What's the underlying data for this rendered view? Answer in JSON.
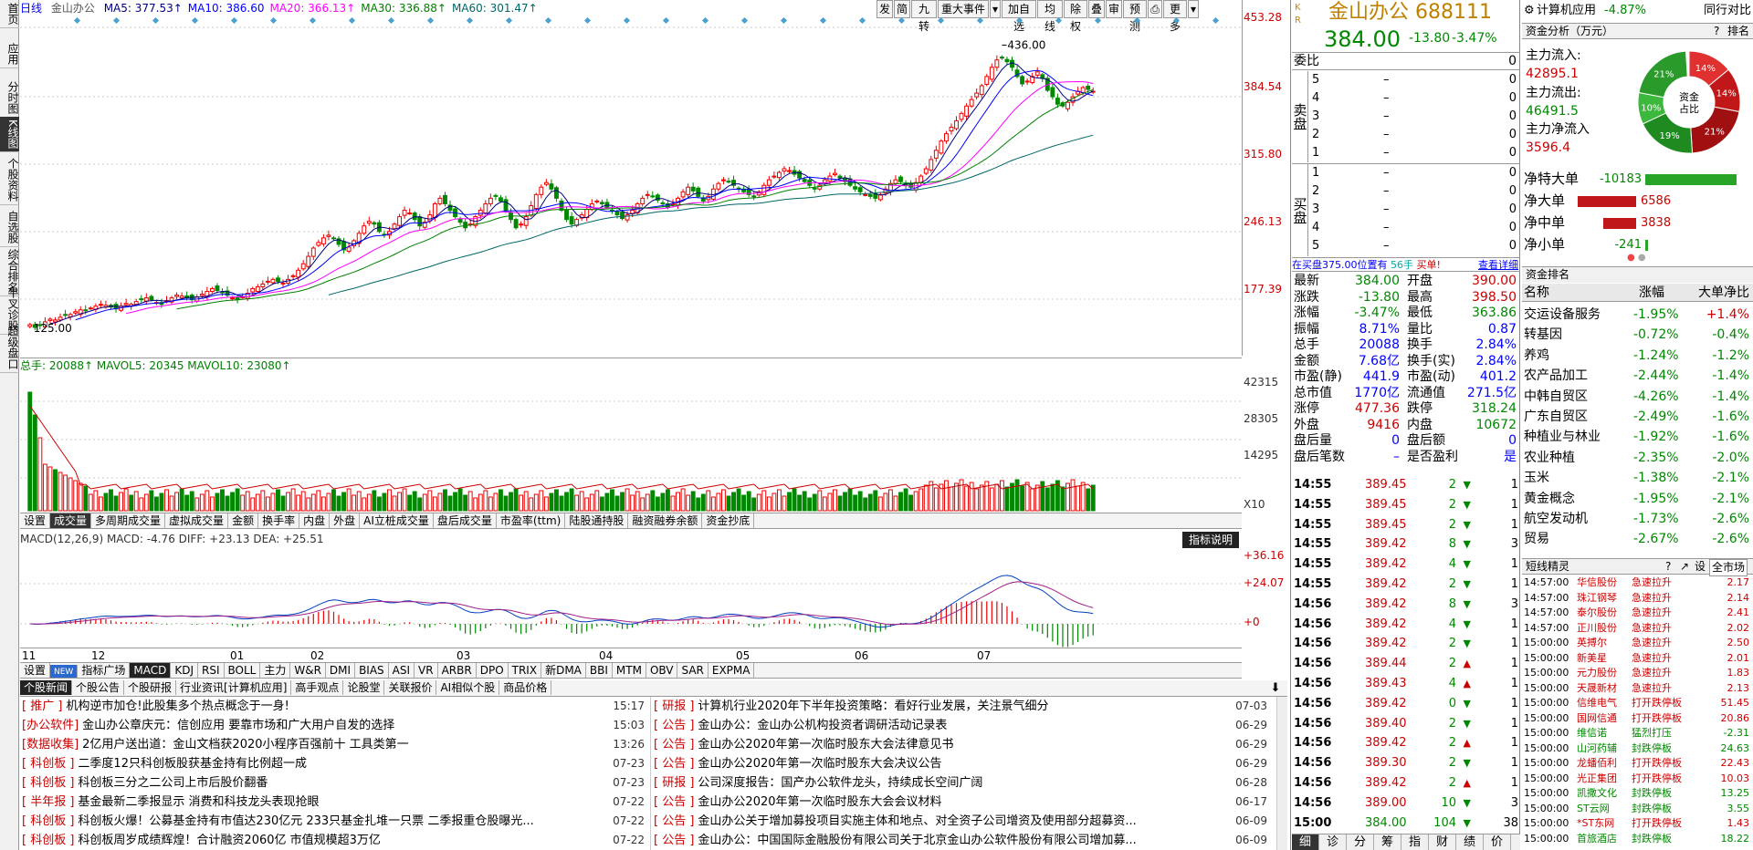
{
  "leftbar": [
    {
      "label": "首页",
      "active": false
    },
    {
      "label": "应用",
      "active": false
    },
    {
      "label": "分时图",
      "active": false
    },
    {
      "label": "K线图",
      "active": true
    },
    {
      "label": "个股资料",
      "active": false
    },
    {
      "label": "自选股",
      "active": false
    },
    {
      "label": "综合排名",
      "active": false
    },
    {
      "label": "牛叉诊股",
      "active": false
    },
    {
      "label": "超级盘口",
      "active": false
    }
  ],
  "main": {
    "period": "日线",
    "name": "金山办公",
    "ma": [
      {
        "label": "MA5: 377.53↑",
        "color": "#000080"
      },
      {
        "label": "MA10: 386.60",
        "color": "#0000ff"
      },
      {
        "label": "MA20: 366.13↑",
        "color": "#ff00ff"
      },
      {
        "label": "MA30: 336.88↑",
        "color": "#008000"
      },
      {
        "label": "MA60: 301.47↑",
        "color": "#006666"
      }
    ],
    "price_ticks": [
      "453.28",
      "384.54",
      "315.80",
      "246.13",
      "177.39"
    ],
    "max_label": "436.00",
    "min_label": "125.00",
    "toolbar": [
      "发",
      "简",
      "九转",
      "重大事件",
      "▾",
      "加自选",
      "均线",
      "除权",
      "叠",
      "审",
      "预测",
      "⎙",
      "更多",
      "▾"
    ]
  },
  "volume": {
    "header": "总手: 20088↑ MAVOL5: 20345 MAVOL10: 23080↑",
    "ticks": [
      "42315",
      "28305",
      "14295"
    ],
    "unit": "X10",
    "tabs": [
      "设置",
      "成交量",
      "多周期成交量",
      "虚拟成交量",
      "金额",
      "换手率",
      "内盘",
      "外盘",
      "AI立桩成交量",
      "盘后成交量",
      "市盈率(ttm)",
      "陆股通持股",
      "融资融券余额",
      "资金抄底"
    ]
  },
  "macd": {
    "header": "MACD(12,26,9)  MACD: -4.76  DIFF: +23.13  DEA: +25.51",
    "button": "指标说明",
    "ticks": [
      "+36.16",
      "+24.07",
      "+0"
    ]
  },
  "months": [
    "11",
    "12",
    "01",
    "02",
    "03",
    "04",
    "05",
    "06",
    "07"
  ],
  "indicator_tabs": [
    "设置",
    "NEW",
    "指标广场",
    "MACD",
    "KDJ",
    "RSI",
    "BOLL",
    "主力",
    "W&R",
    "DMI",
    "BIAS",
    "ASI",
    "VR",
    "ARBR",
    "DPO",
    "TRIX",
    "新DMA",
    "BBI",
    "MTM",
    "OBV",
    "SAR",
    "EXPMA"
  ],
  "news_tabs": [
    "个股新闻",
    "个股公告",
    "个股研报",
    "行业资讯[计算机应用]",
    "高手观点",
    "论股堂",
    "关联报价",
    "AI相似个股",
    "商品价格"
  ],
  "news_left": [
    {
      "tag": "[ 推广 ]",
      "title": "机构逆市加仓!此股集多个热点概念于一身!",
      "time": "15:17"
    },
    {
      "tag": "[办公软件]",
      "title": "金山办公章庆元：信创应用 要靠市场和广大用户自发的选择",
      "time": "15:03"
    },
    {
      "tag": "[数据收集]",
      "title": "2亿用户送出道：金山文档获2020小程序百强前十 工具类第一",
      "time": "13:26"
    },
    {
      "tag": "[ 科创板 ]",
      "title": "二季度12只科创板股获基金持有比例超一成",
      "time": "07-23"
    },
    {
      "tag": "[ 科创板 ]",
      "title": "科创板三分之二公司上市后股价翻番",
      "time": "07-23"
    },
    {
      "tag": "[ 半年报 ]",
      "title": "基金最新二季报显示 消费和科技龙头表现抢眼",
      "time": "07-22"
    },
    {
      "tag": "[ 科创板 ]",
      "title": "科创板火爆！公募基金持有市值达230亿元 233只基金扎堆一只票 二季报重仓股曝光...",
      "time": "07-22"
    },
    {
      "tag": "[ 科创板 ]",
      "title": "科创板周岁成绩辉煌！合计融资2060亿 市值规模超3万亿",
      "time": "07-22"
    }
  ],
  "news_right": [
    {
      "tag": "[ 研报 ]",
      "title": "计算机行业2020年下半年投资策略：看好行业发展，关注景气细分",
      "time": "07-03"
    },
    {
      "tag": "[ 公告 ]",
      "title": "金山办公：金山办公机构投资者调研活动记录表",
      "time": "06-29"
    },
    {
      "tag": "[ 公告 ]",
      "title": "金山办公2020年第一次临时股东大会法律意见书",
      "time": "06-29"
    },
    {
      "tag": "[ 公告 ]",
      "title": "金山办公2020年第一次临时股东大会决议公告",
      "time": "06-29"
    },
    {
      "tag": "[ 研报 ]",
      "title": "公司深度报告：国产办公软件龙头，持续成长空间广阔",
      "time": "06-28"
    },
    {
      "tag": "[ 公告 ]",
      "title": "金山办公2020年第一次临时股东大会会议材料",
      "time": "06-17"
    },
    {
      "tag": "[ 公告 ]",
      "title": "金山办公关于增加募投项目实施主体和地点、对全资子公司增资及使用部分超募资...",
      "time": "06-09"
    },
    {
      "tag": "[ 公告 ]",
      "title": "金山办公：中国国际金融股份有限公司关于北京金山办公软件股份有限公司增加募...",
      "time": "06-09"
    }
  ],
  "quote": {
    "kr": "K R",
    "name": "金山办公",
    "code": "688111",
    "price": "384.00",
    "change": "-13.80",
    "pct": "-3.47%",
    "webi": "委比",
    "webi_val": "0",
    "sell_label": "卖盘",
    "buy_label": "买盘",
    "sell": [
      {
        "n": "5",
        "p": "–",
        "v": "0"
      },
      {
        "n": "4",
        "p": "–",
        "v": "0"
      },
      {
        "n": "3",
        "p": "–",
        "v": "0"
      },
      {
        "n": "2",
        "p": "–",
        "v": "0"
      },
      {
        "n": "1",
        "p": "–",
        "v": "0"
      }
    ],
    "buy": [
      {
        "n": "1",
        "p": "–",
        "v": "0"
      },
      {
        "n": "2",
        "p": "–",
        "v": "0"
      },
      {
        "n": "3",
        "p": "–",
        "v": "0"
      },
      {
        "n": "4",
        "p": "–",
        "v": "0"
      },
      {
        "n": "5",
        "p": "–",
        "v": "0"
      }
    ],
    "bar": {
      "a": "在买盘375.00位置有",
      "b": "56手",
      "c": "买单!",
      "d": "查看详细"
    },
    "stats": [
      [
        "最新",
        "384.00",
        "开盘",
        "390.00"
      ],
      [
        "涨跌",
        "-13.80",
        "最高",
        "398.50"
      ],
      [
        "涨幅",
        "-3.47%",
        "最低",
        "363.86"
      ],
      [
        "振幅",
        "8.71%",
        "量比",
        "0.87"
      ],
      [
        "总手",
        "20088",
        "换手",
        "2.84%"
      ],
      [
        "金额",
        "7.68亿",
        "换手(实)",
        "2.84%"
      ],
      [
        "市盈(静)",
        "441.9",
        "市盈(动)",
        "401.2"
      ],
      [
        "总市值",
        "1770亿",
        "流通值",
        "271.5亿"
      ],
      [
        "涨停",
        "477.36",
        "跌停",
        "318.24"
      ],
      [
        "外盘",
        "9416",
        "内盘",
        "10672"
      ],
      [
        "盘后量",
        "0",
        "盘后额",
        "0"
      ],
      [
        "盘后笔数",
        "–",
        "是否盈利",
        "是"
      ]
    ],
    "ticks": [
      {
        "t": "14:55",
        "p": "389.45",
        "v": "2",
        "d": "down",
        "n": "1"
      },
      {
        "t": "14:55",
        "p": "389.45",
        "v": "2",
        "d": "down",
        "n": "1"
      },
      {
        "t": "14:55",
        "p": "389.45",
        "v": "2",
        "d": "down",
        "n": "1"
      },
      {
        "t": "14:55",
        "p": "389.42",
        "v": "8",
        "d": "down",
        "n": "3"
      },
      {
        "t": "14:55",
        "p": "389.42",
        "v": "4",
        "d": "down",
        "n": "1"
      },
      {
        "t": "14:55",
        "p": "389.42",
        "v": "2",
        "d": "down",
        "n": "1"
      },
      {
        "t": "14:56",
        "p": "389.42",
        "v": "8",
        "d": "down",
        "n": "3"
      },
      {
        "t": "14:56",
        "p": "389.42",
        "v": "4",
        "d": "down",
        "n": "1"
      },
      {
        "t": "14:56",
        "p": "389.42",
        "v": "2",
        "d": "down",
        "n": "1"
      },
      {
        "t": "14:56",
        "p": "389.44",
        "v": "2",
        "d": "up",
        "n": "1"
      },
      {
        "t": "14:56",
        "p": "389.43",
        "v": "4",
        "d": "up",
        "n": "1"
      },
      {
        "t": "14:56",
        "p": "389.42",
        "v": "0",
        "d": "down",
        "n": "1"
      },
      {
        "t": "14:56",
        "p": "389.40",
        "v": "2",
        "d": "down",
        "n": "1"
      },
      {
        "t": "14:56",
        "p": "389.42",
        "v": "2",
        "d": "up",
        "n": "1"
      },
      {
        "t": "14:56",
        "p": "389.30",
        "v": "2",
        "d": "down",
        "n": "1"
      },
      {
        "t": "14:56",
        "p": "389.42",
        "v": "2",
        "d": "up",
        "n": "1"
      },
      {
        "t": "14:56",
        "p": "389.00",
        "v": "10",
        "d": "down",
        "n": "3"
      },
      {
        "t": "15:00",
        "p": "384.00",
        "v": "104",
        "d": "down",
        "n": "38"
      }
    ],
    "bottom_tabs": [
      "细",
      "诊",
      "分",
      "筹",
      "指",
      "财",
      "绩",
      "价"
    ]
  },
  "side": {
    "sector": "计算机应用",
    "sector_pct": "-4.87%",
    "header_right": "同行对比",
    "fund_title": "资金分析（万元）",
    "fund_q": "?",
    "fund_rank_link": "排名",
    "inflow_label": "主力流入:",
    "inflow": "42895.1",
    "outflow_label": "主力流出:",
    "outflow": "46491.5",
    "net_label": "主力净流入",
    "net": "3596.4",
    "donut_center": "资金占比",
    "donut_labels": [
      "21%",
      "14%",
      "14%",
      "21%",
      "19%",
      "10%"
    ],
    "net_rows": [
      {
        "label": "净特大单",
        "value": "-10183",
        "color": "#28a428",
        "frac": 1.0,
        "dir": "pos"
      },
      {
        "label": "净大单",
        "value": "6586",
        "color": "#c01818",
        "frac": 0.64,
        "dir": "neg"
      },
      {
        "label": "净中单",
        "value": "3838",
        "color": "#c01818",
        "frac": 0.36,
        "dir": "neg"
      },
      {
        "label": "净小单",
        "value": "-241",
        "color": "#28a428",
        "frac": 0.03,
        "dir": "pos"
      }
    ],
    "rank_title": "资金排名",
    "rank_head": [
      "名称",
      "涨幅",
      "大单净比"
    ],
    "sectors": [
      {
        "name": "交运设备服务",
        "pct": "-1.95%",
        "net": "+1.4%"
      },
      {
        "name": "转基因",
        "pct": "-0.72%",
        "net": "-0.4%"
      },
      {
        "name": "养鸡",
        "pct": "-1.24%",
        "net": "-1.2%"
      },
      {
        "name": "农产品加工",
        "pct": "-2.44%",
        "net": "-1.4%"
      },
      {
        "name": "中韩自贸区",
        "pct": "-4.26%",
        "net": "-1.4%"
      },
      {
        "name": "广东自贸区",
        "pct": "-2.49%",
        "net": "-1.6%"
      },
      {
        "name": "种植业与林业",
        "pct": "-1.92%",
        "net": "-1.6%"
      },
      {
        "name": "农业种植",
        "pct": "-2.35%",
        "net": "-2.0%"
      },
      {
        "name": "玉米",
        "pct": "-1.38%",
        "net": "-2.1%"
      },
      {
        "name": "黄金概念",
        "pct": "-1.95%",
        "net": "-2.1%"
      },
      {
        "name": "航空发动机",
        "pct": "-1.73%",
        "net": "-2.6%"
      },
      {
        "name": "贸易",
        "pct": "-2.67%",
        "net": "-2.6%"
      }
    ],
    "sprite_title": "短线精灵",
    "sprite_market": "全市场",
    "sprites": [
      {
        "t": "14:57:00",
        "n": "华信股份",
        "e": "急速拉升",
        "v": "2.17"
      },
      {
        "t": "14:57:00",
        "n": "珠江钢琴",
        "e": "急速拉升",
        "v": "2.14"
      },
      {
        "t": "14:57:00",
        "n": "泰尔股份",
        "e": "急速拉升",
        "v": "2.41"
      },
      {
        "t": "14:57:00",
        "n": "正川股份",
        "e": "急速拉升",
        "v": "2.02"
      },
      {
        "t": "15:00:00",
        "n": "英搏尔",
        "e": "急速拉升",
        "v": "2.50"
      },
      {
        "t": "15:00:00",
        "n": "新美星",
        "e": "急速拉升",
        "v": "2.01"
      },
      {
        "t": "15:00:00",
        "n": "元力股份",
        "e": "急速拉升",
        "v": "1.83"
      },
      {
        "t": "15:00:00",
        "n": "天晟新材",
        "e": "急速拉升",
        "v": "2.13"
      },
      {
        "t": "15:00:00",
        "n": "信维电气",
        "e": "打开跌停板",
        "v": "51.45"
      },
      {
        "t": "15:00:00",
        "n": "国网信通",
        "e": "打开跌停板",
        "v": "20.86"
      },
      {
        "t": "15:00:00",
        "n": "维信诺",
        "e": "猛烈打压",
        "v": "-2.31"
      },
      {
        "t": "15:00:00",
        "n": "山河药辅",
        "e": "封跌停板",
        "v": "24.63"
      },
      {
        "t": "15:00:00",
        "n": "龙蟠佰利",
        "e": "打开跌停板",
        "v": "22.43"
      },
      {
        "t": "15:00:00",
        "n": "光正集团",
        "e": "打开跌停板",
        "v": "10.03"
      },
      {
        "t": "15:00:00",
        "n": "凯撒文化",
        "e": "封跌停板",
        "v": "13.25"
      },
      {
        "t": "15:00:00",
        "n": "ST云网",
        "e": "封跌停板",
        "v": "3.55"
      },
      {
        "t": "15:00:00",
        "n": "*ST东网",
        "e": "打开跌停板",
        "v": "1.43"
      },
      {
        "t": "15:00:00",
        "n": "首旅酒店",
        "e": "封跌停板",
        "v": "18.22"
      }
    ]
  },
  "chart_data": {
    "type": "candlestick",
    "ylim": [
      125,
      453.28
    ],
    "closes": [
      131,
      128,
      130,
      134,
      137,
      136,
      139,
      141,
      142,
      145,
      147,
      146,
      149,
      151,
      153,
      152,
      150,
      148,
      151,
      154,
      153,
      156,
      158,
      160,
      158,
      155,
      153,
      157,
      160,
      163,
      162,
      160,
      158,
      161,
      164,
      167,
      170,
      168,
      166,
      163,
      160,
      158,
      161,
      165,
      170,
      172,
      175,
      178,
      180,
      178,
      176,
      180,
      184,
      190,
      197,
      205,
      214,
      220,
      225,
      228,
      224,
      218,
      212,
      215,
      222,
      230,
      238,
      243,
      240,
      232,
      228,
      232,
      240,
      248,
      255,
      252,
      245,
      238,
      242,
      250,
      262,
      268,
      262,
      255,
      248,
      242,
      236,
      240,
      248,
      255,
      262,
      268,
      270,
      265,
      255,
      245,
      236,
      240,
      248,
      260,
      272,
      280,
      285,
      278,
      268,
      255,
      245,
      240,
      245,
      250,
      256,
      262,
      265,
      262,
      258,
      254,
      250,
      246,
      250,
      255,
      262,
      268,
      272,
      270,
      266,
      262,
      258,
      262,
      268,
      275,
      280,
      276,
      270,
      265,
      270,
      278,
      284,
      288,
      286,
      282,
      278,
      275,
      272,
      270,
      275,
      282,
      288,
      292,
      296,
      300,
      298,
      294,
      290,
      286,
      282,
      278,
      282,
      288,
      292,
      295,
      290,
      286,
      282,
      278,
      275,
      272,
      270,
      268,
      272,
      278,
      284,
      288,
      286,
      282,
      280,
      285,
      292,
      300,
      310,
      320,
      330,
      338,
      345,
      352,
      360,
      368,
      375,
      382,
      390,
      400,
      410,
      418,
      420,
      416,
      410,
      400,
      392,
      395,
      400,
      405,
      398,
      385,
      378,
      370,
      368,
      372,
      378,
      384,
      388,
      386,
      384
    ],
    "max_label": 436.0,
    "min_label": 125.0
  }
}
